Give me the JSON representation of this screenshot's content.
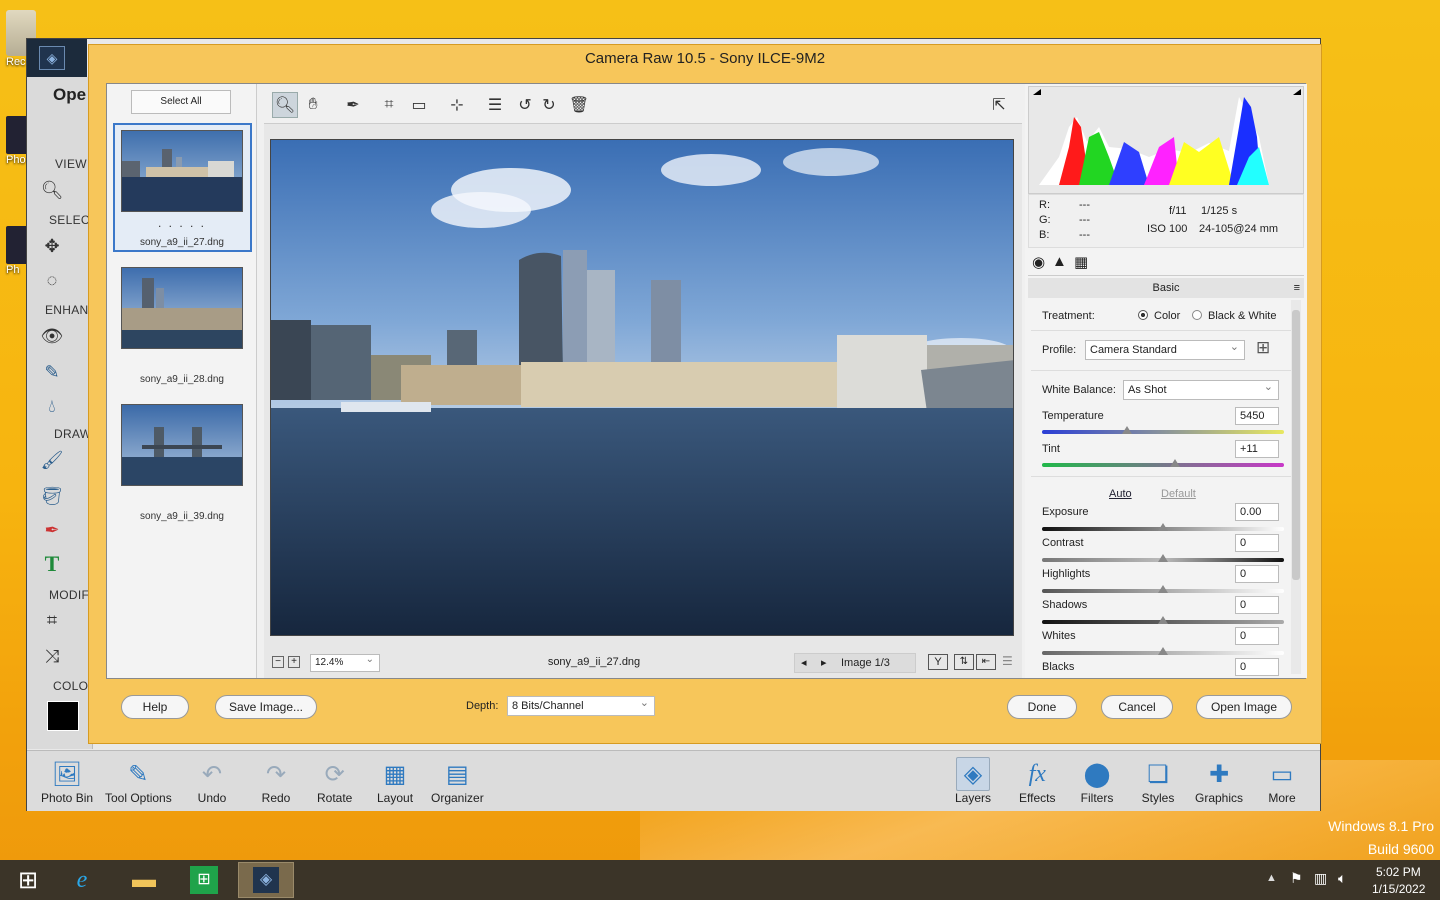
{
  "desktop": {
    "icon_labels": [
      "Rec",
      "Pho",
      "Ph"
    ]
  },
  "pse": {
    "open_label": "Ope",
    "sections": {
      "view": "VIEW",
      "select": "SELEC",
      "enhance": "ENHANC",
      "draw": "DRAW",
      "modify": "MODIF",
      "color": "COLOR"
    },
    "bottom_bar": {
      "photo_bin": "Photo Bin",
      "tool_options": "Tool Options",
      "undo": "Undo",
      "redo": "Redo",
      "rotate": "Rotate",
      "layout": "Layout",
      "organizer": "Organizer",
      "layers": "Layers",
      "effects": "Effects",
      "filters": "Filters",
      "styles": "Styles",
      "graphics": "Graphics",
      "more": "More"
    }
  },
  "camera_raw": {
    "title": "Camera Raw 10.5  -  Sony ILCE-9M2",
    "filmstrip": {
      "select_all": "Select All",
      "dots": ". . . . .",
      "items": [
        {
          "name": "sony_a9_ii_27.dng"
        },
        {
          "name": "sony_a9_ii_28.dng"
        },
        {
          "name": "sony_a9_ii_39.dng"
        }
      ]
    },
    "status": {
      "zoom": "12.4%",
      "filename": "sony_a9_ii_27.dng",
      "image_counter": "Image 1/3"
    },
    "info": {
      "r_label": "R:",
      "g_label": "G:",
      "b_label": "B:",
      "r": "---",
      "g": "---",
      "b": "---",
      "aperture": "f/11",
      "shutter": "1/125 s",
      "iso": "ISO 100",
      "lens": "24-105@24 mm"
    },
    "basic": {
      "header": "Basic",
      "treatment_label": "Treatment:",
      "color_option": "Color",
      "bw_option": "Black & White",
      "profile_label": "Profile:",
      "profile_value": "Camera Standard",
      "wb_label": "White Balance:",
      "wb_value": "As Shot",
      "auto": "Auto",
      "default": "Default",
      "sliders": [
        {
          "label": "Temperature",
          "value": "5450",
          "position": 0.35
        },
        {
          "label": "Tint",
          "value": "+11",
          "position": 0.55
        },
        {
          "label": "Exposure",
          "value": "0.00",
          "position": 0.5
        },
        {
          "label": "Contrast",
          "value": "0",
          "position": 0.5
        },
        {
          "label": "Highlights",
          "value": "0",
          "position": 0.5
        },
        {
          "label": "Shadows",
          "value": "0",
          "position": 0.5
        },
        {
          "label": "Whites",
          "value": "0",
          "position": 0.5
        },
        {
          "label": "Blacks",
          "value": "0",
          "position": 0.5
        }
      ]
    },
    "footer": {
      "help": "Help",
      "save_image": "Save Image...",
      "depth_label": "Depth:",
      "depth_value": "8 Bits/Channel",
      "done": "Done",
      "cancel": "Cancel",
      "open_image": "Open Image"
    }
  },
  "system": {
    "os_name": "Windows 8.1 Pro",
    "build": "Build 9600",
    "time": "5:02 PM",
    "date": "1/15/2022"
  }
}
